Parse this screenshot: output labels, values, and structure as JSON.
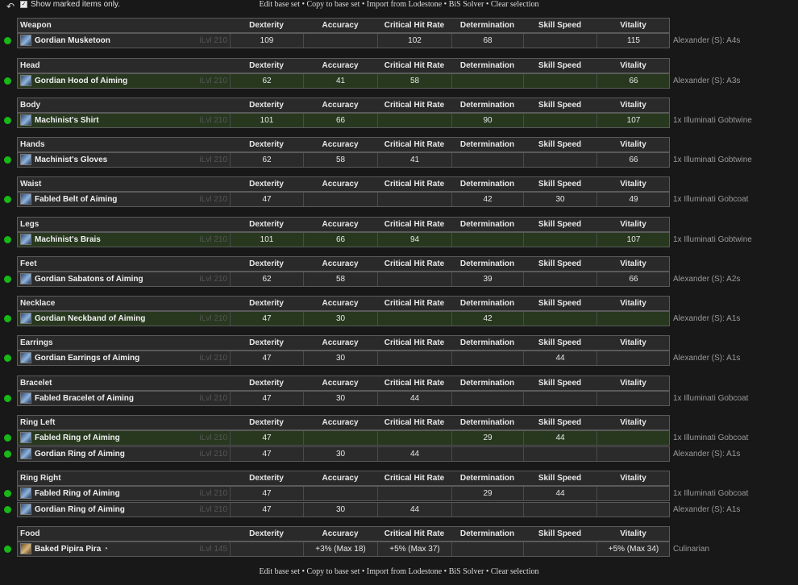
{
  "toolbar": {
    "show_marked_label": "Show marked items only.",
    "show_marked_checked": true,
    "links": [
      "Edit base set",
      "Copy to base set",
      "Import from Lodestone",
      "BiS Solver",
      "Clear selection"
    ],
    "separator": "•"
  },
  "columns": [
    "Dexterity",
    "Accuracy",
    "Critical Hit Rate",
    "Determination",
    "Skill Speed",
    "Vitality"
  ],
  "sections": [
    {
      "slot": "Weapon",
      "items": [
        {
          "name": "Gordian Musketoon",
          "ilvl": "iLvl 210",
          "icon": "gun-icon",
          "stats": [
            "109",
            "",
            "102",
            "68",
            "",
            "115"
          ],
          "source": "Alexander (S): A4s",
          "highlight": false
        }
      ]
    },
    {
      "slot": "Head",
      "items": [
        {
          "name": "Gordian Hood of Aiming",
          "ilvl": "iLvl 210",
          "icon": "hood-icon",
          "stats": [
            "62",
            "41",
            "58",
            "",
            "",
            "66"
          ],
          "source": "Alexander (S): A3s",
          "highlight": true
        }
      ]
    },
    {
      "slot": "Body",
      "items": [
        {
          "name": "Machinist's Shirt",
          "ilvl": "iLvl 210",
          "icon": "shirt-icon",
          "stats": [
            "101",
            "66",
            "",
            "90",
            "",
            "107"
          ],
          "source": "1x Illuminati Gobtwine",
          "highlight": true
        }
      ]
    },
    {
      "slot": "Hands",
      "items": [
        {
          "name": "Machinist's Gloves",
          "ilvl": "iLvl 210",
          "icon": "gloves-icon",
          "stats": [
            "62",
            "58",
            "41",
            "",
            "",
            "66"
          ],
          "source": "1x Illuminati Gobtwine",
          "highlight": false
        }
      ]
    },
    {
      "slot": "Waist",
      "items": [
        {
          "name": "Fabled Belt of Aiming",
          "ilvl": "iLvl 210",
          "icon": "belt-icon",
          "stats": [
            "47",
            "",
            "",
            "42",
            "30",
            "49"
          ],
          "source": "1x Illuminati Gobcoat",
          "highlight": false
        }
      ]
    },
    {
      "slot": "Legs",
      "items": [
        {
          "name": "Machinist's Brais",
          "ilvl": "iLvl 210",
          "icon": "legs-icon",
          "stats": [
            "101",
            "66",
            "94",
            "",
            "",
            "107"
          ],
          "source": "1x Illuminati Gobtwine",
          "highlight": true
        }
      ]
    },
    {
      "slot": "Feet",
      "items": [
        {
          "name": "Gordian Sabatons of Aiming",
          "ilvl": "iLvl 210",
          "icon": "boots-icon",
          "stats": [
            "62",
            "58",
            "",
            "39",
            "",
            "66"
          ],
          "source": "Alexander (S): A2s",
          "highlight": false
        }
      ]
    },
    {
      "slot": "Necklace",
      "items": [
        {
          "name": "Gordian Neckband of Aiming",
          "ilvl": "iLvl 210",
          "icon": "necklace-icon",
          "stats": [
            "47",
            "30",
            "",
            "42",
            "",
            ""
          ],
          "source": "Alexander (S): A1s",
          "highlight": true
        }
      ]
    },
    {
      "slot": "Earrings",
      "items": [
        {
          "name": "Gordian Earrings of Aiming",
          "ilvl": "iLvl 210",
          "icon": "earrings-icon",
          "stats": [
            "47",
            "30",
            "",
            "",
            "44",
            ""
          ],
          "source": "Alexander (S): A1s",
          "highlight": false
        }
      ]
    },
    {
      "slot": "Bracelet",
      "items": [
        {
          "name": "Fabled Bracelet of Aiming",
          "ilvl": "iLvl 210",
          "icon": "bracelet-icon",
          "stats": [
            "47",
            "30",
            "44",
            "",
            "",
            ""
          ],
          "source": "1x Illuminati Gobcoat",
          "highlight": false
        }
      ]
    },
    {
      "slot": "Ring Left",
      "items": [
        {
          "name": "Fabled Ring of Aiming",
          "ilvl": "iLvl 210",
          "icon": "ring-icon",
          "stats": [
            "47",
            "",
            "",
            "29",
            "44",
            ""
          ],
          "source": "1x Illuminati Gobcoat",
          "highlight": true
        },
        {
          "name": "Gordian Ring of Aiming",
          "ilvl": "iLvl 210",
          "icon": "ring-icon",
          "stats": [
            "47",
            "30",
            "44",
            "",
            "",
            ""
          ],
          "source": "Alexander (S): A1s",
          "highlight": false
        }
      ]
    },
    {
      "slot": "Ring Right",
      "items": [
        {
          "name": "Fabled Ring of Aiming",
          "ilvl": "iLvl 210",
          "icon": "ring-icon",
          "stats": [
            "47",
            "",
            "",
            "29",
            "44",
            ""
          ],
          "source": "1x Illuminati Gobcoat",
          "highlight": false
        },
        {
          "name": "Gordian Ring of Aiming",
          "ilvl": "iLvl 210",
          "icon": "ring-icon",
          "stats": [
            "47",
            "30",
            "44",
            "",
            "",
            ""
          ],
          "source": "Alexander (S): A1s",
          "highlight": false
        }
      ]
    },
    {
      "slot": "Food",
      "items": [
        {
          "name": "Baked Pipira Pira",
          "hq": true,
          "ilvl": "iLvl 145",
          "icon": "food-icon",
          "stats": [
            "",
            "+3% (Max 18)",
            "+5% (Max 37)",
            "",
            "",
            "+5% (Max 34)"
          ],
          "source": "Culinarian",
          "highlight": false
        }
      ]
    }
  ],
  "colors": {
    "background": "#181818",
    "row": "#2b2b2b",
    "highlight_row": "#27381f",
    "marker": "#17b817",
    "border": "#5a5a5a"
  }
}
